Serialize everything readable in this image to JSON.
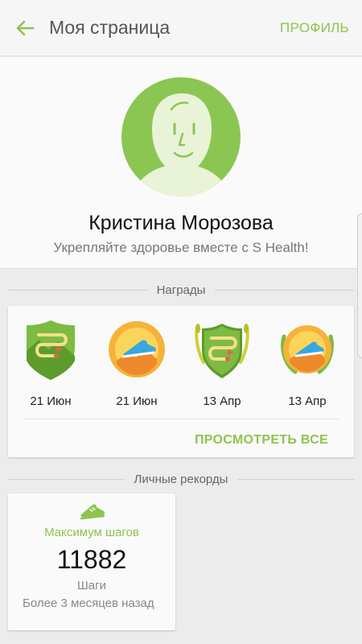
{
  "header": {
    "title": "Моя страница",
    "profile_link": "ПРОФИЛЬ"
  },
  "profile": {
    "name": "Кристина Морозова",
    "subtitle": "Укрепляйте здоровье вместе с S Health!"
  },
  "awards": {
    "section_title": "Награды",
    "items": [
      {
        "date": "21 Июн",
        "icon": "route-shield-badge-icon"
      },
      {
        "date": "21 Июн",
        "icon": "sneaker-gold-medal-icon"
      },
      {
        "date": "13 Апр",
        "icon": "route-shield-laurel-badge-icon"
      },
      {
        "date": "13 Апр",
        "icon": "sneaker-gold-laurel-medal-icon"
      }
    ],
    "view_all": "ПРОСМОТРЕТЬ ВСЕ"
  },
  "records": {
    "section_title": "Личные рекорды",
    "card": {
      "icon": "sneaker-icon",
      "title": "Максимум шагов",
      "value": "11882",
      "unit": "Шаги",
      "note": "Более 3 месяцев назад"
    }
  },
  "colors": {
    "accent": "#8dc44e",
    "avatar": "#8bc653",
    "gold": "#f7b23b"
  }
}
